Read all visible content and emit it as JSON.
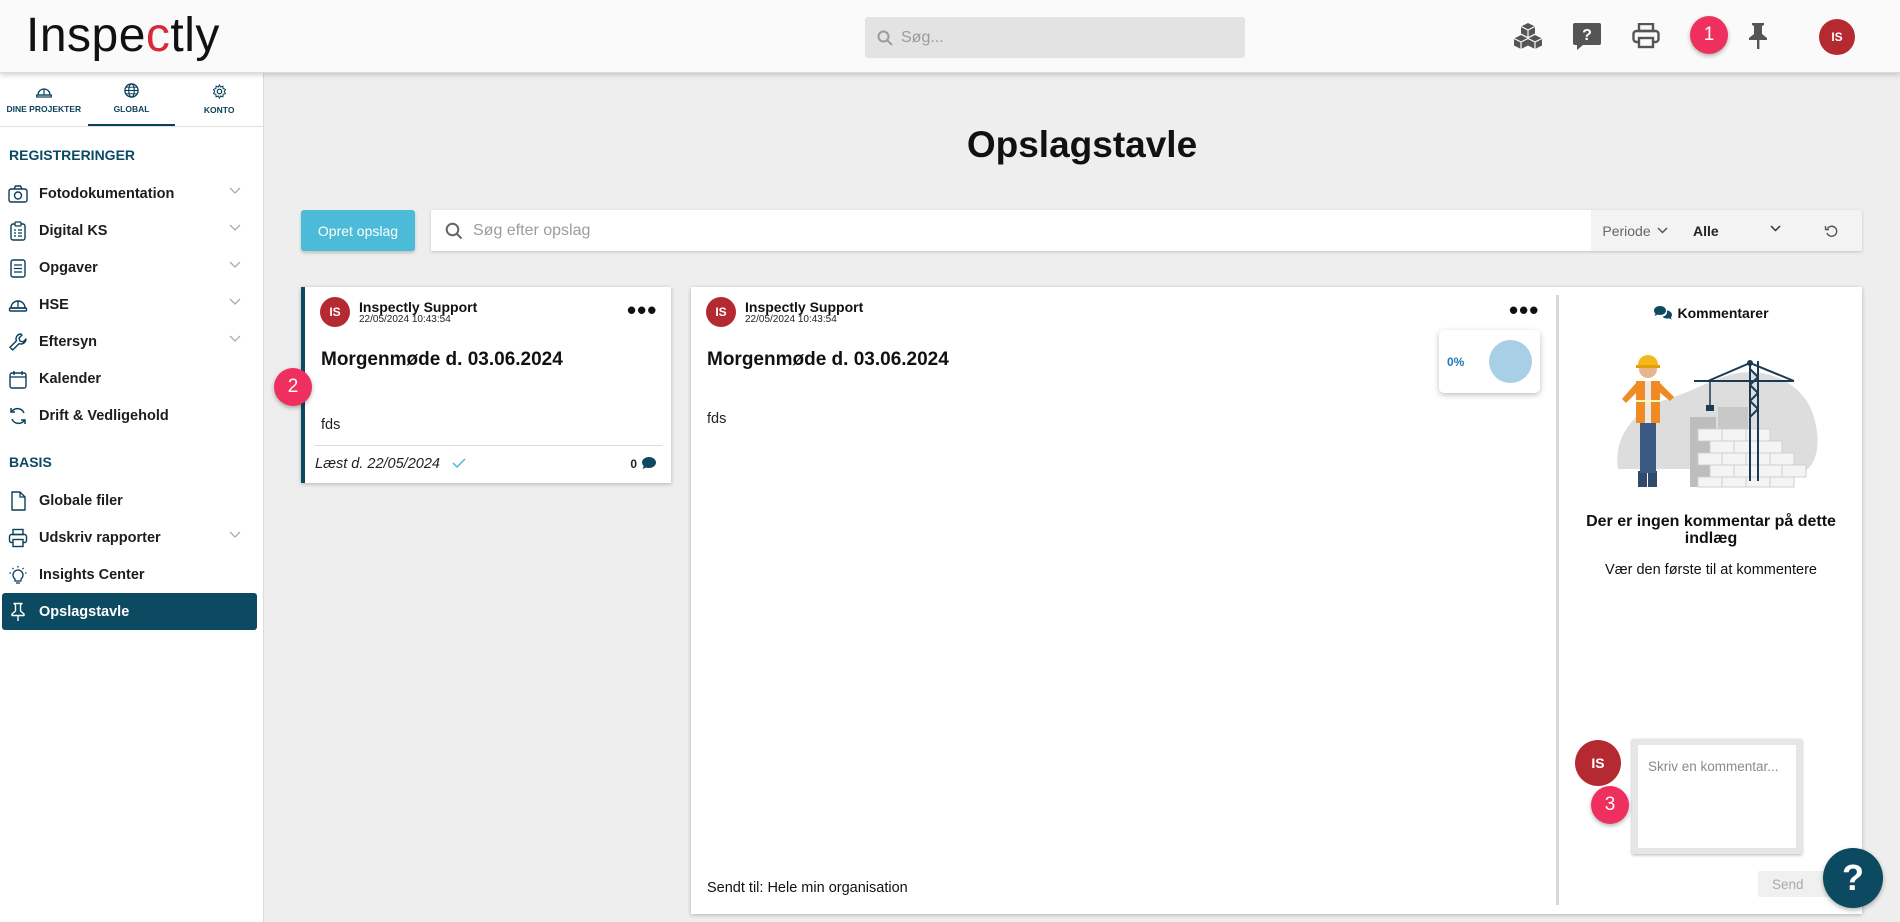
{
  "app": {
    "logo_text_1": "Inspe",
    "logo_text_2": "c",
    "logo_text_3": "tly",
    "accent": "#0c4a62",
    "brand_red": "#d8283a"
  },
  "topbar": {
    "search_placeholder": "Søg...",
    "user_initials": "IS",
    "icons": [
      "cubes-icon",
      "help-icon",
      "print-icon",
      "pin-icon"
    ]
  },
  "sidebar": {
    "tabs": [
      {
        "label": "DINE PROJEKTER",
        "icon": "helmet-icon"
      },
      {
        "label": "GLOBAL",
        "icon": "globe-icon",
        "active": true
      },
      {
        "label": "KONTO",
        "icon": "gear-icon"
      }
    ],
    "section1": "REGISTRERINGER",
    "items1": [
      {
        "label": "Fotodokumentation",
        "icon": "camera-icon",
        "expandable": true
      },
      {
        "label": "Digital KS",
        "icon": "clipboard-icon",
        "expandable": true
      },
      {
        "label": "Opgaver",
        "icon": "task-list-icon",
        "expandable": true
      },
      {
        "label": "HSE",
        "icon": "hard-hat-icon",
        "expandable": true
      },
      {
        "label": "Eftersyn",
        "icon": "wrench-icon",
        "expandable": true
      },
      {
        "label": "Kalender",
        "icon": "calendar-icon",
        "expandable": false
      },
      {
        "label": "Drift & Vedligehold",
        "icon": "refresh-icon",
        "expandable": false
      }
    ],
    "section2": "BASIS",
    "items2": [
      {
        "label": "Globale filer",
        "icon": "file-icon",
        "expandable": false
      },
      {
        "label": "Udskriv rapporter",
        "icon": "printer-icon",
        "expandable": true
      },
      {
        "label": "Insights Center",
        "icon": "lightbulb-icon",
        "expandable": false
      },
      {
        "label": "Opslagstavle",
        "icon": "pushpin-icon",
        "expandable": false,
        "active": true
      }
    ]
  },
  "main": {
    "title": "Opslagstavle",
    "create_button": "Opret opslag",
    "search_placeholder": "Søg efter opslag",
    "period_label": "Periode",
    "filter_value": "Alle"
  },
  "post_card": {
    "initials": "IS",
    "author": "Inspectly Support",
    "date": "22/05/2024 10:43:54",
    "title": "Morgenmøde d. 03.06.2024",
    "body": "fds",
    "read_label": "Læst d. 22/05/2024",
    "comment_count": "0"
  },
  "post_detail": {
    "initials": "IS",
    "author": "Inspectly Support",
    "date": "22/05/2024 10:43:54",
    "title": "Morgenmøde d. 03.06.2024",
    "body": "fds",
    "progress_label": "0%",
    "progress": 0,
    "sent_to": "Sendt til: Hele min organisation"
  },
  "comments": {
    "heading": "Kommentarer",
    "empty_title": "Der er ingen kommentar på dette indlæg",
    "empty_sub": "Vær den første til at kommentere",
    "user_initials": "IS",
    "input_placeholder": "Skriv en kommentar...",
    "send_label": "Send"
  },
  "markers": [
    "1",
    "2",
    "3"
  ],
  "help_fab": "?"
}
